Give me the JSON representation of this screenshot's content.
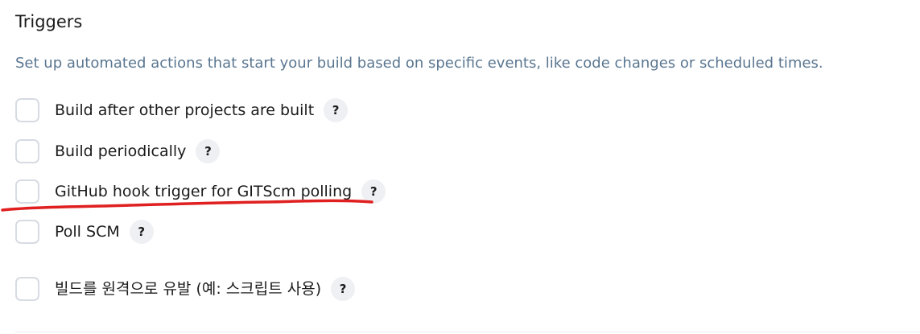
{
  "section": {
    "title": "Triggers",
    "description": "Set up automated actions that start your build based on specific events, like code changes or scheduled times."
  },
  "triggers": [
    {
      "label": "Build after other projects are built",
      "checked": false,
      "help": "?"
    },
    {
      "label": "Build periodically",
      "checked": false,
      "help": "?"
    },
    {
      "label": "GitHub hook trigger for GITScm polling",
      "checked": false,
      "help": "?"
    },
    {
      "label": "Poll SCM",
      "checked": false,
      "help": "?"
    },
    {
      "label": "빌드를 원격으로 유발 (예: 스크립트 사용)",
      "checked": false,
      "help": "?"
    }
  ],
  "annotation": {
    "color": "#e02020",
    "target": "GitHub hook trigger for GITScm polling"
  },
  "colors": {
    "description": "#5a7690",
    "checkbox_border": "#d7dbe2",
    "help_background": "#eef0f3"
  }
}
